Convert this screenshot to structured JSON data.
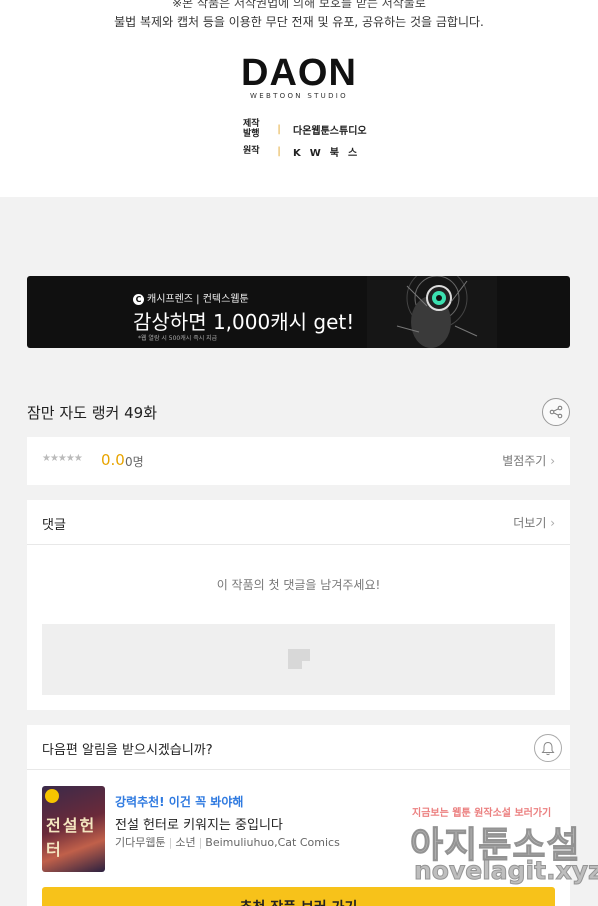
{
  "top": {
    "notice_line1": "※본 작품은 저작권법에 의해 보호를 받는 저작물로",
    "notice_line2": "불법 복제와 캡처 등을 이용한 무단 전재 및 유포, 공유하는 것을 금합니다.",
    "logo_main": "DAON",
    "logo_sub": "WEBTOON STUDIO",
    "credits": [
      {
        "key": "제작\n발행",
        "value": "다온웹툰스튜디오"
      },
      {
        "key": "원작",
        "value": "KW북스"
      }
    ]
  },
  "banner": {
    "brand": "캐시프렌즈 | 컨텍스웹툰",
    "headline": "감상하면 1,000캐시 get!",
    "small": "*웹 열람 시 500캐시 즉시 지급"
  },
  "episode": {
    "title": "잠만 자도 랭커 49화"
  },
  "rating": {
    "stars": "★★★★★",
    "score": "0.0",
    "votes": "0명",
    "rate_link": "별점주기"
  },
  "comments": {
    "title": "댓글",
    "more": "더보기",
    "empty_message": "이 작품의 첫 댓글을 남겨주세요!"
  },
  "alarm": {
    "title": "다음편 알림을 받으시겠습니까?"
  },
  "recommend": {
    "tag": "강력추천! 이건 꼭 봐야해",
    "name": "전설 헌터로 키워지는 중입니다",
    "genre": "기다무웹툰",
    "category": "소년",
    "authors": "Beimuliuhuo,Cat Comics",
    "thumb_text": "전설헌터",
    "cta": "추천 작품 보러 가기"
  },
  "watermark": {
    "line1": "지금보는 웹툰 원작소설 보러가기",
    "line2": "아지툰소설",
    "line3": "novelagit.xyz"
  },
  "colors": {
    "accent_yellow": "#f7c21a",
    "score_orange": "#e8a400",
    "tag_blue": "#2f7ae0"
  }
}
